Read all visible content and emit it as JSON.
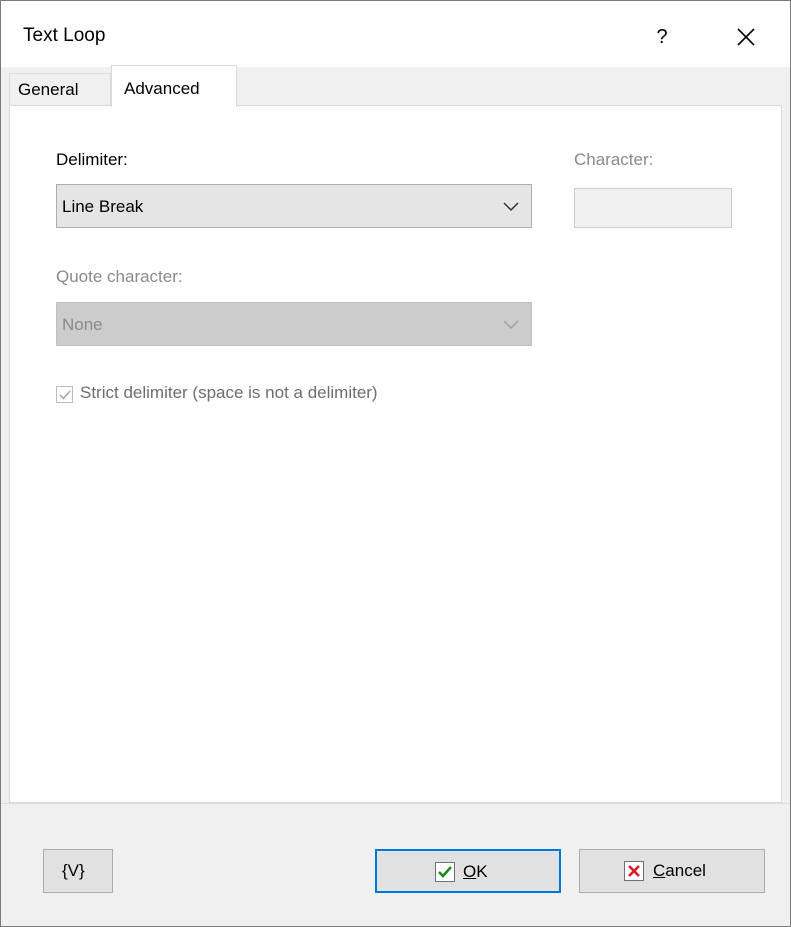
{
  "window": {
    "title": "Text Loop",
    "help_label": "?"
  },
  "tabs": [
    {
      "label": "General",
      "active": false
    },
    {
      "label": "Advanced",
      "active": true
    }
  ],
  "delimiter": {
    "label": "Delimiter:",
    "value": "Line Break"
  },
  "character": {
    "label": "Character:",
    "value": ""
  },
  "quote": {
    "label": "Quote character:",
    "value": "None"
  },
  "strict": {
    "label": "Strict delimiter (space is not a delimiter)",
    "checked": true,
    "enabled": false
  },
  "buttons": {
    "variables_label": "{V}",
    "ok_mnemonic": "O",
    "ok_rest": "K",
    "cancel_mnemonic": "C",
    "cancel_rest": "ancel"
  },
  "colors": {
    "accent": "#0078d7",
    "ok_check": "#1e8a1e",
    "cancel_x": "#d4202c",
    "disabled_text": "#8a8a8a"
  },
  "icons": [
    "help-icon",
    "close-icon",
    "chevron-down-icon",
    "checkmark-icon",
    "ok-check-icon",
    "cancel-x-icon"
  ]
}
